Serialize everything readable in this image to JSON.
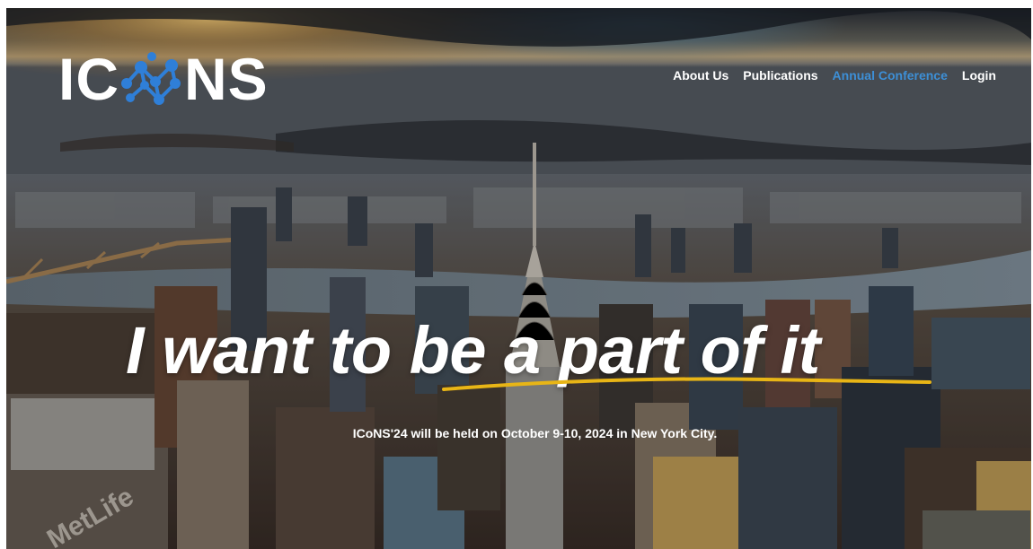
{
  "brand": {
    "logo_left": "IC",
    "logo_right": "NS"
  },
  "nav": {
    "items": [
      {
        "label": "About Us",
        "active": false
      },
      {
        "label": "Publications",
        "active": false
      },
      {
        "label": "Annual Conference",
        "active": true
      },
      {
        "label": "Login",
        "active": false
      }
    ],
    "active_color": "#3d8fd6"
  },
  "hero": {
    "headline": "I want to be a part of it",
    "subline": "ICoNS'24 will be held on October 9-10, 2024 in New York City.",
    "underline_color": "#e8b516",
    "background_scene": "new-york-city-skyline-aerial"
  },
  "colors": {
    "logo_molecule": "#2f7fd8",
    "text": "#ffffff"
  }
}
